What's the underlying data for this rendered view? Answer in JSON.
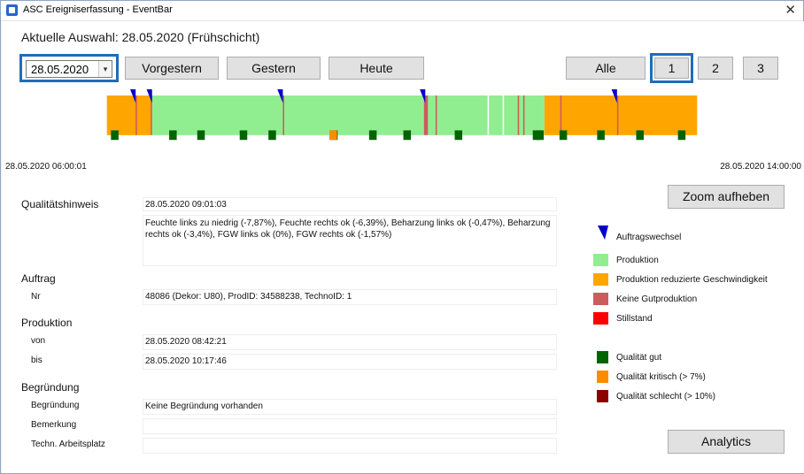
{
  "window": {
    "title": "ASC Ereigniserfassung - EventBar",
    "close_glyph": "✕"
  },
  "selection": {
    "label": "Aktuelle Auswahl: 28.05.2020 (Frühschicht)"
  },
  "date_picker": {
    "value": "28.05.2020",
    "dropdown_glyph": "▾"
  },
  "nav": {
    "vorgestern": "Vorgestern",
    "gestern": "Gestern",
    "heute": "Heute"
  },
  "shifts": {
    "alle": "Alle",
    "s1": "1",
    "s2": "2",
    "s3": "3",
    "selected": "1"
  },
  "timeline": {
    "start_label": "28.05.2020 06:00:01",
    "end_label": "28.05.2020 14:00:00",
    "colors": {
      "produktion": "#90ee90",
      "reduziert": "#ffa500",
      "keine_gut": "#cd5c5c",
      "stillstand": "#ff0000",
      "q_gut": "#006400",
      "q_kritisch": "#ff8c00",
      "q_schlecht": "#8b0000",
      "wechsel": "#0000cd"
    }
  },
  "zoom_button": "Zoom aufheben",
  "analytics_button": "Analytics",
  "details": {
    "qualitaet_header": "Qualitätshinweis",
    "qualitaet_time": "28.05.2020 09:01:03",
    "qualitaet_text": "Feuchte links zu niedrig (-7,87%), Feuchte rechts ok (-6,39%), Beharzung links ok (-0,47%), Beharzung rechts ok (-3,4%), FGW links ok (0%), FGW rechts ok (-1,57%)",
    "auftrag_header": "Auftrag",
    "nr_label": "Nr",
    "nr_value": "48086 (Dekor: U80), ProdID: 34588238, TechnoID: 1",
    "produktion_header": "Produktion",
    "von_label": "von",
    "von_value": "28.05.2020 08:42:21",
    "bis_label": "bis",
    "bis_value": "28.05.2020 10:17:46",
    "begruendung_header": "Begründung",
    "begruendung_label": "Begründung",
    "begruendung_value": "Keine Begründung vorhanden",
    "bemerkung_label": "Bemerkung",
    "bemerkung_value": "",
    "arbeitsplatz_label": "Techn. Arbeitsplatz",
    "arbeitsplatz_value": ""
  },
  "legend": {
    "wechsel": "Auftragswechsel",
    "produktion": "Produktion",
    "reduziert": "Produktion reduzierte Geschwindigkeit",
    "keine_gut": "Keine Gutproduktion",
    "stillstand": "Stillstand",
    "q_gut": "Qualität gut",
    "q_kritisch": "Qualität kritisch (> 7%)",
    "q_schlecht": "Qualität schlecht (> 10%)"
  }
}
